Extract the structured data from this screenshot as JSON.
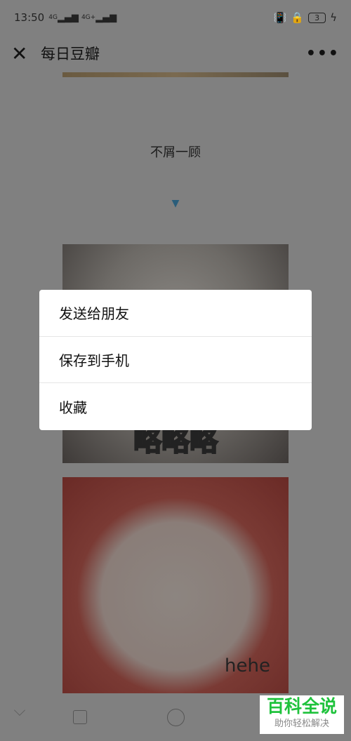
{
  "status_bar": {
    "time": "13:50",
    "signal1": "4G",
    "signal2": "4G+",
    "battery": "3"
  },
  "nav": {
    "close_icon": "close-icon",
    "title": "每日豆瓣",
    "more_icon": "more-icon"
  },
  "content": {
    "caption": "不屑一顾",
    "arrow": "▼",
    "image2_text": "略略略",
    "image3_text": "hehe"
  },
  "context_menu": {
    "items": [
      {
        "label": "发送给朋友"
      },
      {
        "label": "保存到手机"
      },
      {
        "label": "收藏"
      }
    ]
  },
  "watermark": {
    "title": "百科全说",
    "subtitle": "助你轻松解决"
  }
}
